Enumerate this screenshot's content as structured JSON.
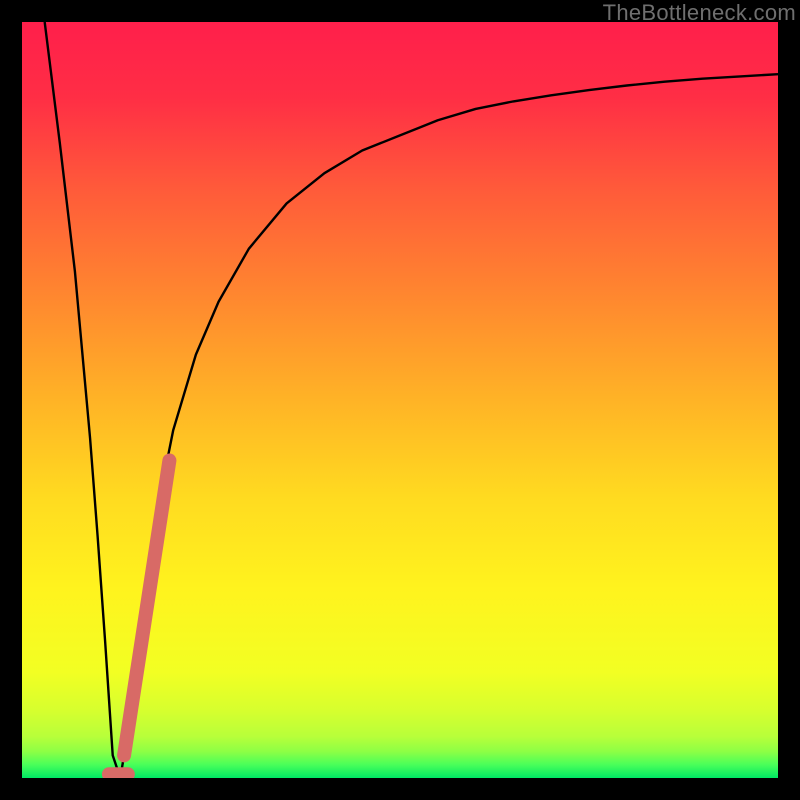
{
  "watermark": "TheBottleneck.com",
  "chart_data": {
    "type": "line",
    "title": "",
    "xlabel": "",
    "ylabel": "",
    "xlim": [
      0,
      100
    ],
    "ylim": [
      0,
      100
    ],
    "grid": false,
    "legend": false,
    "description": "Bottleneck percentage curve over a red-to-green vertical gradient. Curve drops from 100 at x≈3 to 0 near x≈12, then rises asymptotically toward ~93 at x=100. A salmon highlight segment lies on the rising branch around x≈14–19 and a short flat segment at the trough.",
    "series": [
      {
        "name": "bottleneck-curve",
        "x": [
          3,
          5,
          7,
          9,
          10,
          11,
          12,
          13,
          14,
          16,
          18,
          20,
          23,
          26,
          30,
          35,
          40,
          45,
          50,
          55,
          60,
          65,
          70,
          75,
          80,
          85,
          90,
          95,
          100
        ],
        "y": [
          100,
          84,
          67,
          45,
          32,
          18,
          3,
          0,
          6,
          22,
          36,
          46,
          56,
          63,
          70,
          76,
          80,
          83,
          85,
          87,
          88.5,
          89.5,
          90.3,
          91,
          91.6,
          92.1,
          92.5,
          92.8,
          93.1
        ]
      },
      {
        "name": "highlight-rising",
        "x": [
          13.5,
          19.5
        ],
        "y": [
          3,
          42
        ]
      },
      {
        "name": "highlight-trough",
        "x": [
          11.5,
          14
        ],
        "y": [
          0.5,
          0.5
        ]
      }
    ],
    "gradient_stops": [
      {
        "offset": 0.0,
        "color": "#ff1f4b"
      },
      {
        "offset": 0.1,
        "color": "#ff2e45"
      },
      {
        "offset": 0.22,
        "color": "#ff5a3a"
      },
      {
        "offset": 0.35,
        "color": "#ff8330"
      },
      {
        "offset": 0.5,
        "color": "#ffb326"
      },
      {
        "offset": 0.63,
        "color": "#ffdb20"
      },
      {
        "offset": 0.75,
        "color": "#fff31e"
      },
      {
        "offset": 0.86,
        "color": "#f2ff23"
      },
      {
        "offset": 0.91,
        "color": "#d7ff2e"
      },
      {
        "offset": 0.945,
        "color": "#b8ff3a"
      },
      {
        "offset": 0.965,
        "color": "#8dff45"
      },
      {
        "offset": 0.982,
        "color": "#4bff59"
      },
      {
        "offset": 1.0,
        "color": "#00e864"
      }
    ],
    "colors": {
      "curve": "#000000",
      "highlight": "#d86a66"
    }
  }
}
